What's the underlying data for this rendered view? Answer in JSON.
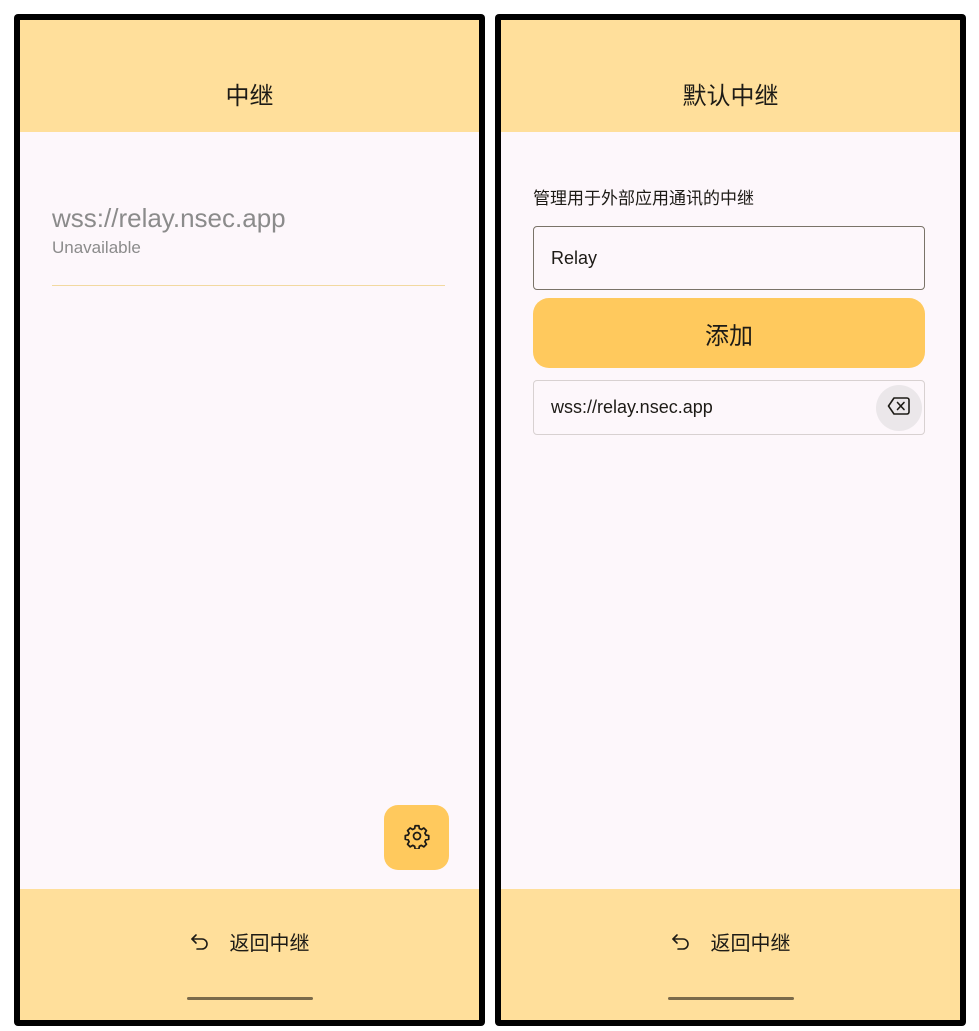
{
  "left_screen": {
    "title": "中继",
    "relay": {
      "url": "wss://relay.nsec.app",
      "status": "Unavailable"
    },
    "fab_icon": "settings-gear-icon",
    "bottom_nav": {
      "back_icon": "undo-arrow-icon",
      "back_label": "返回中继"
    }
  },
  "right_screen": {
    "title": "默认中继",
    "description": "管理用于外部应用通讯的中继",
    "input": {
      "value": "Relay"
    },
    "add_button_label": "添加",
    "relays": [
      {
        "url": "wss://relay.nsec.app",
        "delete_icon": "backspace-x-icon"
      }
    ],
    "bottom_nav": {
      "back_icon": "undo-arrow-icon",
      "back_label": "返回中继"
    }
  },
  "colors": {
    "bar": "#ffdf9b",
    "accent": "#ffc95d",
    "background": "#fdf7fb",
    "text": "#1d1b16",
    "muted_text": "#8b8b8b"
  }
}
